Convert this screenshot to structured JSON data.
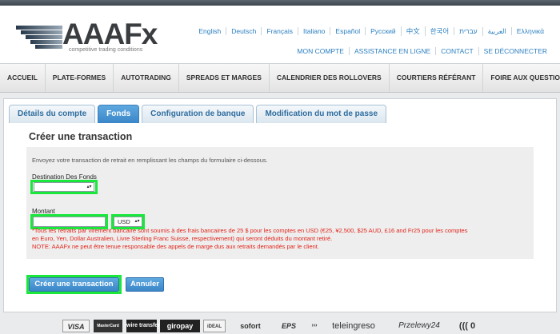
{
  "brand": {
    "name": "AAAFx",
    "tagline": "competitive trading conditions"
  },
  "languages": [
    "English",
    "Deutsch",
    "Français",
    "Italiano",
    "Español",
    "Русский",
    "中文",
    "한국어",
    "עברית",
    "العربية",
    "Ελληνικά"
  ],
  "account_links": [
    "MON COMPTE",
    "ASSISTANCE EN LIGNE",
    "CONTACT",
    "SE DÉCONNECTER"
  ],
  "nav": [
    "ACCUEIL",
    "PLATE-FORMES",
    "AUTOTRADING",
    "SPREADS ET MARGES",
    "CALENDRIER DES ROLLOVERS",
    "COURTIERS RÉFÉRANT",
    "FOIRE AUX QUESTIONS"
  ],
  "tabs": [
    {
      "label": "Détails du compte",
      "active": false
    },
    {
      "label": "Fonds",
      "active": true
    },
    {
      "label": "Configuration de banque",
      "active": false
    },
    {
      "label": "Modification du mot de passe",
      "active": false
    }
  ],
  "page_title": "Créer une transaction",
  "form": {
    "intro": "Envoyez votre transaction de retrait en remplissant les champs du formulaire ci-dessous.",
    "destination_label": "Destination Des Fonds",
    "destination_value": "",
    "amount_label": "Montant",
    "amount_value": "",
    "currency_value": "USD",
    "note_line1": "*Tous les retraits par virement bancaire sont soumis à des frais bancaires de 25 $ pour les comptes en USD (€25, ¥2,500, $25 AUD, £16 and Fr25 pour les comptes",
    "note_line2": "en Euro, Yen, Dollar Australien, Livre Sterling Franc Suisse, respectivement) qui seront déduits du montant retiré.",
    "note_line3": "NOTE: AAAFx ne peut être tenue responsable des appels de marge dus aux retraits demandés par le client.",
    "submit_label": "Créer une transaction",
    "cancel_label": "Annuler"
  },
  "payment_methods": [
    "VISA",
    "MasterCard",
    "wire transfer",
    "giropay",
    "iDEAL",
    "sofort",
    "EPS",
    "teleingreso",
    "Przelewy24"
  ],
  "colors": {
    "accent": "#3a86c8",
    "link": "#2b7fc0",
    "highlight": "#19e83b",
    "warning": "#e1251b"
  }
}
